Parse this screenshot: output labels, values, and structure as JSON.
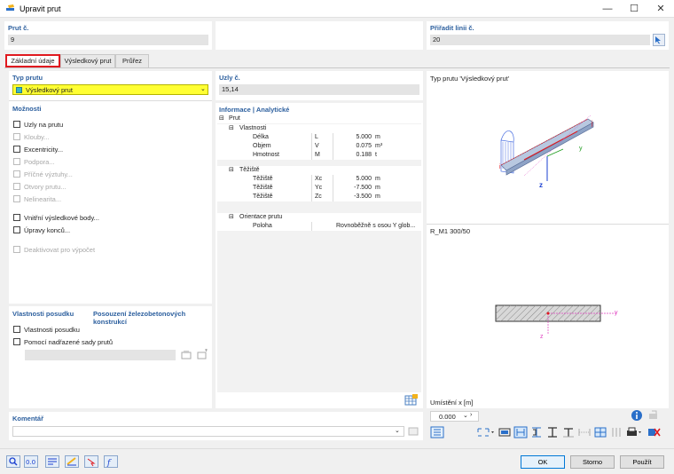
{
  "window": {
    "title": "Upravit prut",
    "minimize": "—",
    "maximize": "☐",
    "close": "✕"
  },
  "header": {
    "member_no_label": "Prut č.",
    "member_no_value": "9",
    "assign_line_label": "Přiřadit linii č.",
    "assign_line_value": "20"
  },
  "tabs": [
    {
      "label": "Základní údaje"
    },
    {
      "label": "Výsledkový prut"
    },
    {
      "label": "Průřez"
    }
  ],
  "member_type": {
    "label": "Typ prutu",
    "value": "Výsledkový prut",
    "color": "#ffff33"
  },
  "options": {
    "label": "Možnosti",
    "items": [
      {
        "label": "Uzly na prutu",
        "enabled": true
      },
      {
        "label": "Klouby...",
        "enabled": false
      },
      {
        "label": "Excentricity...",
        "enabled": true
      },
      {
        "label": "Podpora...",
        "enabled": false
      },
      {
        "label": "Příčné výztuhy...",
        "enabled": false
      },
      {
        "label": "Otvory prutu...",
        "enabled": false
      },
      {
        "label": "Nelinearita...",
        "enabled": false
      },
      {
        "label": "Vnitřní výsledkové body...",
        "enabled": true
      },
      {
        "label": "Úpravy konců...",
        "enabled": true
      },
      {
        "label": "Deaktivovat pro výpočet",
        "enabled": false
      }
    ]
  },
  "design": {
    "label": "Vlastnosti posudku",
    "link": "Posouzení železobetonových konstrukcí",
    "items": [
      {
        "label": "Vlastnosti posudku"
      },
      {
        "label": "Pomocí nadřazené sady prutů"
      }
    ]
  },
  "nodes": {
    "label": "Uzly č.",
    "value": "15,14"
  },
  "info": {
    "label": "Informace | Analytické",
    "root": "Prut",
    "groups": [
      {
        "name": "Vlastnosti",
        "rows": [
          {
            "name": "Délka",
            "sym": "L",
            "value": "5.000",
            "unit": "m"
          },
          {
            "name": "Objem",
            "sym": "V",
            "value": "0.075",
            "unit": "m³"
          },
          {
            "name": "Hmotnost",
            "sym": "M",
            "value": "0.188",
            "unit": "t"
          }
        ]
      },
      {
        "name": "Těžiště",
        "rows": [
          {
            "name": "Těžiště",
            "sym": "Xc",
            "value": "5.000",
            "unit": "m"
          },
          {
            "name": "Těžiště",
            "sym": "Yc",
            "value": "-7.500",
            "unit": "m"
          },
          {
            "name": "Těžiště",
            "sym": "Zc",
            "value": "-3.500",
            "unit": "m"
          }
        ]
      },
      {
        "name": "Orientace prutu",
        "rows": [
          {
            "name": "Poloha",
            "sym": "",
            "value": "Rovnoběžně s osou Y glob...",
            "unit": ""
          }
        ]
      }
    ]
  },
  "preview": {
    "title": "Typ prutu 'Výsledkový prut'",
    "section_title": "R_M1 300/50",
    "axis_z": "z",
    "axis_y": "y",
    "axis_i": "i",
    "axis_j": "j",
    "position_label": "Umístění x [m]",
    "position_value": "0.000"
  },
  "comment": {
    "label": "Komentář",
    "value": ""
  },
  "buttons": {
    "ok": "OK",
    "cancel": "Storno",
    "apply": "Použít"
  }
}
